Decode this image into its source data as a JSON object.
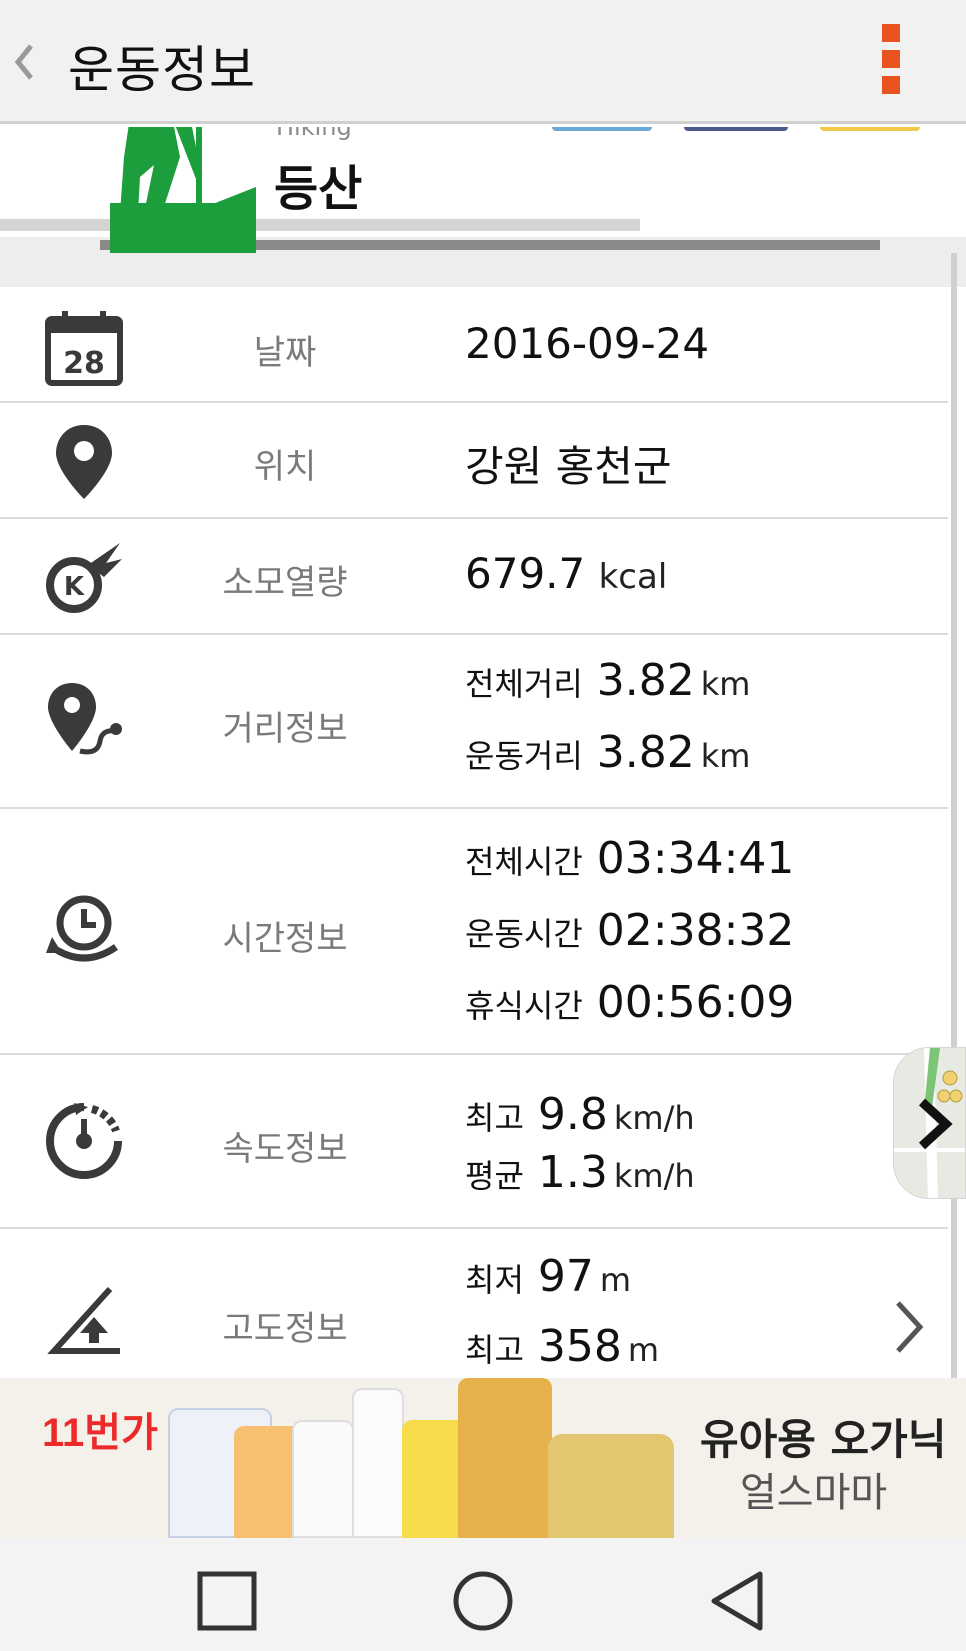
{
  "header": {
    "title": "운동정보",
    "back_icon": "chevron-left-icon",
    "menu_icon": "more-vert-icon",
    "accent_color": "#e8531f"
  },
  "activity": {
    "name_en": "Hiking",
    "name_ko": "등산",
    "icon": "hiker-icon",
    "icon_color": "#1b9e3b"
  },
  "rows": {
    "date": {
      "icon": "calendar-icon",
      "icon_text": "28",
      "label": "날짜",
      "value": "2016-09-24"
    },
    "location": {
      "icon": "location-pin-icon",
      "label": "위치",
      "value": "강원 홍천군"
    },
    "calories": {
      "icon": "calorie-burn-icon",
      "label": "소모열량",
      "value": "679.7",
      "unit": "kcal"
    },
    "distance": {
      "icon": "route-pin-icon",
      "label": "거리정보",
      "total_label": "전체거리",
      "total_value": "3.82",
      "total_unit": "km",
      "exercise_label": "운동거리",
      "exercise_value": "3.82",
      "exercise_unit": "km"
    },
    "time": {
      "icon": "time-cycle-icon",
      "label": "시간정보",
      "total_label": "전체시간",
      "total_value": "03:34:41",
      "exercise_label": "운동시간",
      "exercise_value": "02:38:32",
      "rest_label": "휴식시간",
      "rest_value": "00:56:09"
    },
    "speed": {
      "icon": "speedometer-icon",
      "label": "속도정보",
      "max_label": "최고",
      "max_value": "9.8",
      "max_unit": "km/h",
      "avg_label": "평균",
      "avg_value": "1.3",
      "avg_unit": "km/h"
    },
    "altitude": {
      "icon": "altitude-icon",
      "label": "고도정보",
      "min_label": "최저",
      "min_value": "97",
      "min_unit": "m",
      "max_label": "최고",
      "max_value": "358",
      "max_unit": "m"
    }
  },
  "map_thumb": {
    "icon": "chevron-right-icon"
  },
  "ad": {
    "logo": "11번가",
    "headline": "유아용 오가닉",
    "subline": "얼스마마"
  },
  "navbar": {
    "recents_icon": "square-icon",
    "home_icon": "circle-icon",
    "back_icon": "triangle-back-icon"
  }
}
